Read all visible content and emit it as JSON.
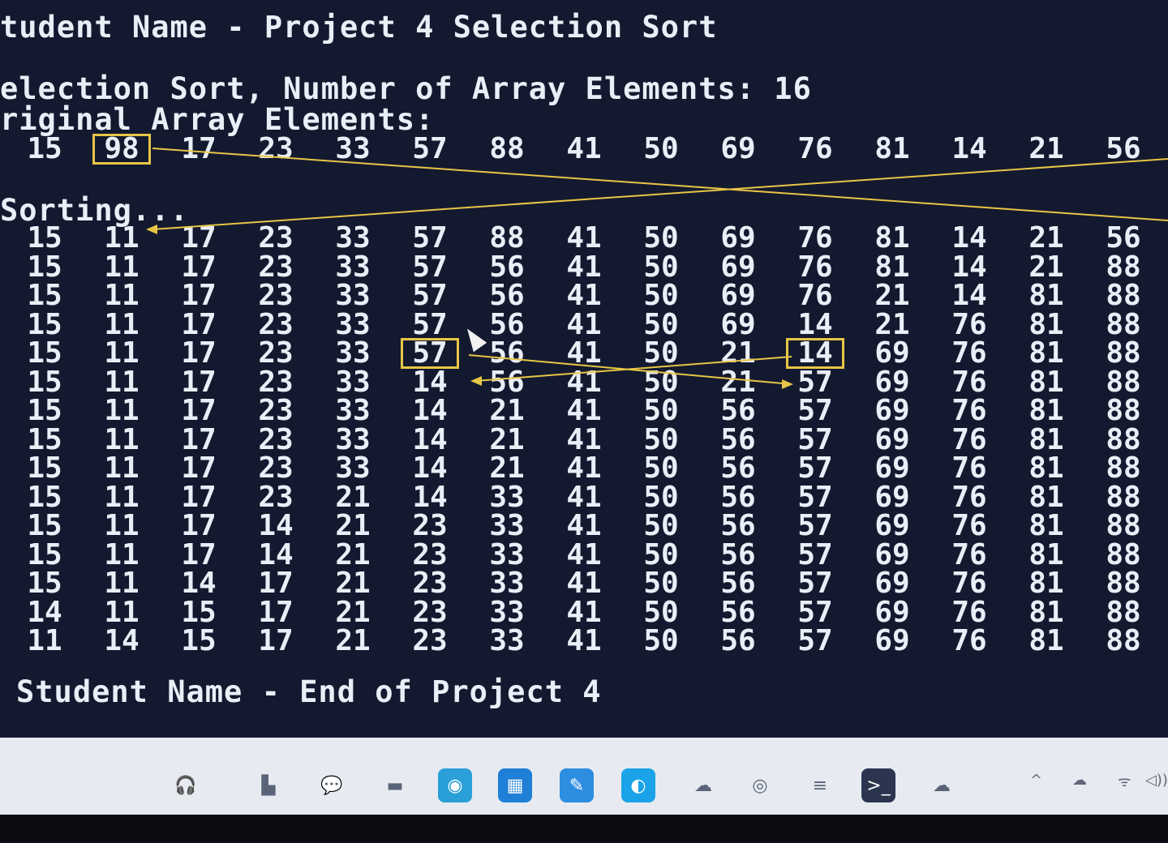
{
  "console": {
    "title_line": "tudent Name - Project 4 Selection Sort",
    "count_line": "election Sort, Number of Array Elements: 16",
    "original_label": "riginal Array Elements:",
    "original_values": [
      "15",
      "98",
      "17",
      "23",
      "33",
      "57",
      "88",
      "41",
      "50",
      "69",
      "76",
      "81",
      "14",
      "21",
      "56"
    ],
    "sorting_label": "Sorting...",
    "rows": [
      [
        "15",
        "11",
        "17",
        "23",
        "33",
        "57",
        "88",
        "41",
        "50",
        "69",
        "76",
        "81",
        "14",
        "21",
        "56"
      ],
      [
        "15",
        "11",
        "17",
        "23",
        "33",
        "57",
        "56",
        "41",
        "50",
        "69",
        "76",
        "81",
        "14",
        "21",
        "88"
      ],
      [
        "15",
        "11",
        "17",
        "23",
        "33",
        "57",
        "56",
        "41",
        "50",
        "69",
        "76",
        "21",
        "14",
        "81",
        "88"
      ],
      [
        "15",
        "11",
        "17",
        "23",
        "33",
        "57",
        "56",
        "41",
        "50",
        "69",
        "14",
        "21",
        "76",
        "81",
        "88"
      ],
      [
        "15",
        "11",
        "17",
        "23",
        "33",
        "57",
        "56",
        "41",
        "50",
        "21",
        "14",
        "69",
        "76",
        "81",
        "88"
      ],
      [
        "15",
        "11",
        "17",
        "23",
        "33",
        "14",
        "56",
        "41",
        "50",
        "21",
        "57",
        "69",
        "76",
        "81",
        "88"
      ],
      [
        "15",
        "11",
        "17",
        "23",
        "33",
        "14",
        "21",
        "41",
        "50",
        "56",
        "57",
        "69",
        "76",
        "81",
        "88"
      ],
      [
        "15",
        "11",
        "17",
        "23",
        "33",
        "14",
        "21",
        "41",
        "50",
        "56",
        "57",
        "69",
        "76",
        "81",
        "88"
      ],
      [
        "15",
        "11",
        "17",
        "23",
        "33",
        "14",
        "21",
        "41",
        "50",
        "56",
        "57",
        "69",
        "76",
        "81",
        "88"
      ],
      [
        "15",
        "11",
        "17",
        "23",
        "21",
        "14",
        "33",
        "41",
        "50",
        "56",
        "57",
        "69",
        "76",
        "81",
        "88"
      ],
      [
        "15",
        "11",
        "17",
        "14",
        "21",
        "23",
        "33",
        "41",
        "50",
        "56",
        "57",
        "69",
        "76",
        "81",
        "88"
      ],
      [
        "15",
        "11",
        "17",
        "14",
        "21",
        "23",
        "33",
        "41",
        "50",
        "56",
        "57",
        "69",
        "76",
        "81",
        "88"
      ],
      [
        "15",
        "11",
        "14",
        "17",
        "21",
        "23",
        "33",
        "41",
        "50",
        "56",
        "57",
        "69",
        "76",
        "81",
        "88"
      ],
      [
        "14",
        "11",
        "15",
        "17",
        "21",
        "23",
        "33",
        "41",
        "50",
        "56",
        "57",
        "69",
        "76",
        "81",
        "88"
      ],
      [
        "11",
        "14",
        "15",
        "17",
        "21",
        "23",
        "33",
        "41",
        "50",
        "56",
        "57",
        "69",
        "76",
        "81",
        "88"
      ]
    ],
    "end_line": "Student Name - End of Project 4"
  },
  "annotations": {
    "highlight_color": "#e8c547",
    "boxes": [
      {
        "row": "original",
        "col": 1
      },
      {
        "row": 4,
        "col": 5
      },
      {
        "row": 4,
        "col": 10
      }
    ]
  },
  "taskbar": {
    "icons": [
      {
        "name": "headset-icon",
        "glyph": "🎧",
        "color": "#e7eaf0"
      },
      {
        "name": "explorer-icon",
        "glyph": "▙",
        "color": "#e7eaf0"
      },
      {
        "name": "chat-icon",
        "glyph": "💬",
        "color": "#e7eaf0"
      },
      {
        "name": "minimized-app-icon",
        "glyph": "▬",
        "color": "#e7eaf0"
      },
      {
        "name": "edge-icon",
        "glyph": "◉",
        "color": "#2a9fd8"
      },
      {
        "name": "store-icon",
        "glyph": "▦",
        "color": "#1f7fd6"
      },
      {
        "name": "vscode-icon",
        "glyph": "✎",
        "color": "#2d8de0"
      },
      {
        "name": "browser-icon",
        "glyph": "◐",
        "color": "#1aa3e8"
      },
      {
        "name": "teams-icon",
        "glyph": "☁",
        "color": "#e7eaf0"
      },
      {
        "name": "chrome-icon",
        "glyph": "◎",
        "color": "#e7eaf0"
      },
      {
        "name": "notepad-icon",
        "glyph": "≡",
        "color": "#e7eaf0"
      },
      {
        "name": "terminal-icon",
        "glyph": ">_",
        "color": "#2b3550"
      },
      {
        "name": "weather-icon",
        "glyph": "☁",
        "color": "#e7eaf0"
      }
    ],
    "tray": {
      "chevron": "^",
      "cloud": "☁",
      "wifi": "ᯤ",
      "volume": "◁))"
    }
  }
}
